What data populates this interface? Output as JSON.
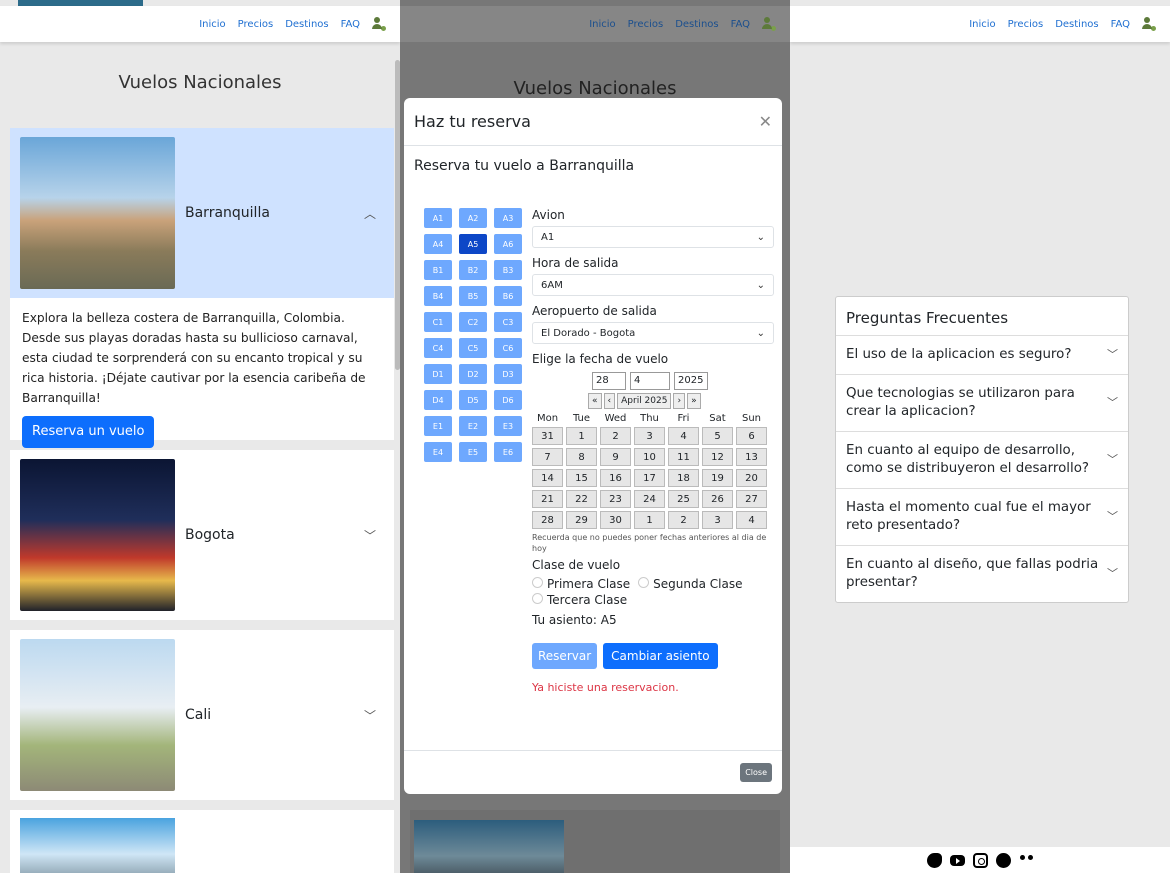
{
  "nav": {
    "items": [
      "Inicio",
      "Precios",
      "Destinos",
      "FAQ"
    ]
  },
  "left": {
    "title": "Vuelos Nacionales",
    "cards": [
      {
        "label": "Barranquilla",
        "expanded": true
      },
      {
        "label": "Bogota",
        "expanded": false
      },
      {
        "label": "Cali",
        "expanded": false
      }
    ],
    "description": "Explora la belleza costera de Barranquilla, Colombia. Desde sus playas doradas hasta su bullicioso carnaval, esta ciudad te sorprenderá con su encanto tropical y su rica historia. ¡Déjate cautivar por la esencia caribeña de Barranquilla!",
    "reserve_button": "Reserva un vuelo"
  },
  "modal": {
    "title_behind": "Vuelos Nacionales",
    "title": "Haz tu reserva",
    "subtitle": "Reserva tu vuelo a Barranquilla",
    "seats": [
      "A1",
      "A2",
      "A3",
      "A4",
      "A5",
      "A6",
      "B1",
      "B2",
      "B3",
      "B4",
      "B5",
      "B6",
      "C1",
      "C2",
      "C3",
      "C4",
      "C5",
      "C6",
      "D1",
      "D2",
      "D3",
      "D4",
      "D5",
      "D6",
      "E1",
      "E2",
      "E3",
      "E4",
      "E5",
      "E6"
    ],
    "selected_seat": "A5",
    "avion_label": "Avion",
    "avion_value": "A1",
    "hora_label": "Hora de salida",
    "hora_value": "6AM",
    "aeropuerto_label": "Aeropuerto de salida",
    "aeropuerto_value": "El Dorado - Bogota",
    "fecha_label": "Elige la fecha de vuelo",
    "date_day": "28",
    "date_month": "4",
    "date_year": "2025",
    "month_label": "April 2025",
    "weekdays": [
      "Mon",
      "Tue",
      "Wed",
      "Thu",
      "Fri",
      "Sat",
      "Sun"
    ],
    "days": [
      "31",
      "1",
      "2",
      "3",
      "4",
      "5",
      "6",
      "7",
      "8",
      "9",
      "10",
      "11",
      "12",
      "13",
      "14",
      "15",
      "16",
      "17",
      "18",
      "19",
      "20",
      "21",
      "22",
      "23",
      "24",
      "25",
      "26",
      "27",
      "28",
      "29",
      "30",
      "1",
      "2",
      "3",
      "4"
    ],
    "note": "Recuerda que no puedes poner fechas anteriores al dia de hoy",
    "clase_label": "Clase de vuelo",
    "clases": [
      "Primera Clase",
      "Segunda Clase",
      "Tercera Clase"
    ],
    "asiento_text": "Tu asiento: A5",
    "btn_reservar": "Reservar",
    "btn_cambiar": "Cambiar asiento",
    "error": "Ya hiciste una reservacion.",
    "btn_close": "Close"
  },
  "faq": {
    "title": "Preguntas Frecuentes",
    "items": [
      "El uso de la aplicacion es seguro?",
      "Que tecnologias se utilizaron para crear la aplicacion?",
      "En cuanto al equipo de desarrollo, como se distribuyeron el desarrollo?",
      "Hasta el momento cual fue el mayor reto presentado?",
      "En cuanto al diseño, que fallas podria presentar?"
    ]
  },
  "footer_icons": [
    "twitter-icon",
    "youtube-icon",
    "instagram-icon",
    "facebook-icon",
    "users-icon"
  ]
}
